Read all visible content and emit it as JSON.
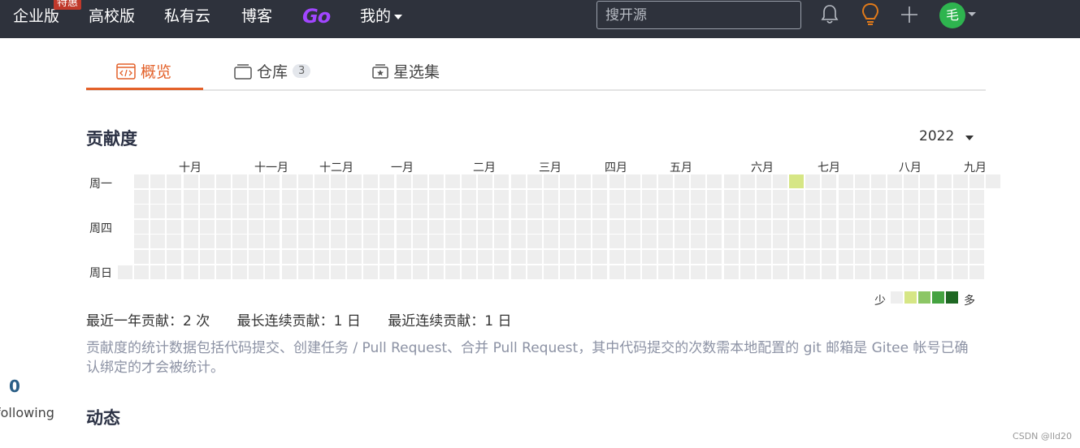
{
  "nav": {
    "enterprise": "企业版",
    "special_badge": "特惠",
    "university": "高校版",
    "private_cloud": "私有云",
    "blog": "博客",
    "go": "Go",
    "mine": "我的",
    "search_placeholder": "搜开源",
    "avatar_text": "毛",
    "icons": [
      "bell-icon",
      "lightbulb-icon",
      "plus-icon"
    ],
    "colors": {
      "bar": "#2e323c",
      "go": "#a146ff",
      "avatar": "#2eb44f",
      "bulb": "#e07a1a"
    }
  },
  "tabs": [
    {
      "label": "概览",
      "icon": "code-window-icon",
      "active": true
    },
    {
      "label": "仓库",
      "icon": "repo-icon",
      "count": "3"
    },
    {
      "label": "星选集",
      "icon": "star-box-icon"
    }
  ],
  "contribution": {
    "title": "贡献度",
    "year": "2022",
    "months": [
      "十月",
      "十一月",
      "十二月",
      "一月",
      "二月",
      "三月",
      "四月",
      "五月",
      "六月",
      "七月",
      "八月",
      "九月"
    ],
    "weekdays": [
      "周一",
      "周四",
      "周日"
    ],
    "legend": {
      "less": "少",
      "more": "多",
      "colors": [
        "#eeeeee",
        "#d6e685",
        "#8cc665",
        "#44a340",
        "#1e6823"
      ]
    },
    "highlight_color": "#d6e685",
    "stats": {
      "year_total": "最近一年贡献：2 次",
      "longest_streak": "最长连续贡献：1 日",
      "current_streak": "最近连续贡献：1 日"
    },
    "note": "贡献度的统计数据包括代码提交、创建任务 / Pull Request、合并 Pull Request，其中代码提交的次数需本地配置的 git 邮箱是 Gitee 帐号已确认绑定的才会被统计。"
  },
  "activity": {
    "title": "动态"
  },
  "sidebar": {
    "following_count": "0",
    "following_label": "following"
  },
  "watermark": "CSDN @lld20"
}
